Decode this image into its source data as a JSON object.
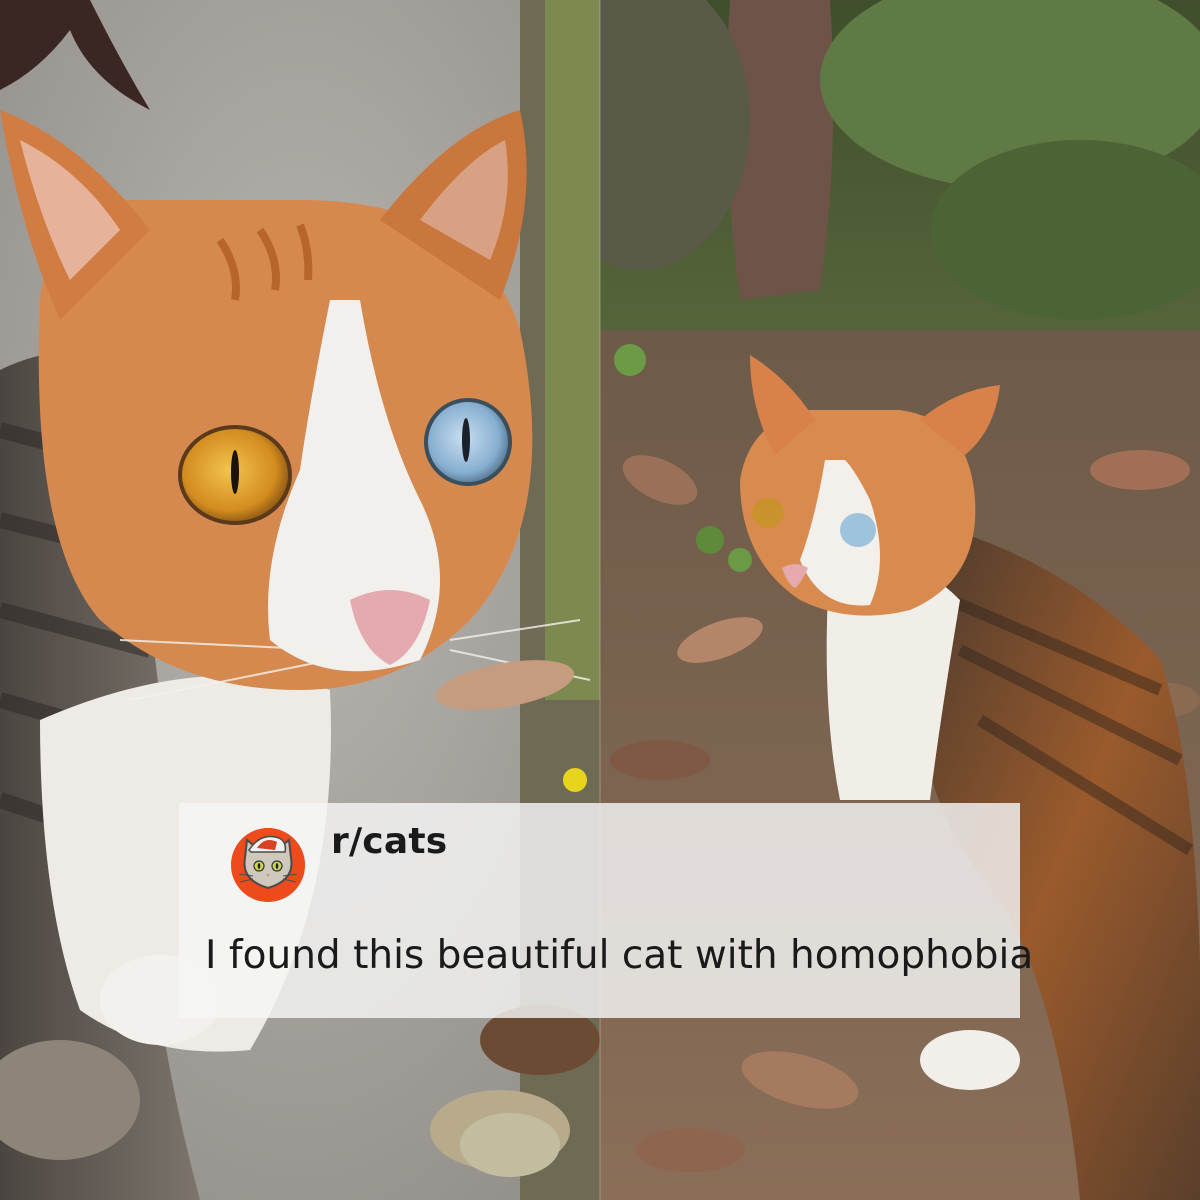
{
  "post": {
    "subreddit": "r/cats",
    "title": "I found this beautiful cat with homophobia"
  },
  "icons": {
    "avatar": "reddit-cat-snoo-avatar"
  },
  "colors": {
    "avatar_bg": "#ee4b1c",
    "card_bg": "#f5f5f5",
    "text": "#1a1a1b"
  },
  "photos": {
    "left": "close-up of orange-and-white tabby cat with one amber eye and one blue eye on pavement",
    "right": "same heterochromic cat sitting among fallen leaves and plants"
  }
}
